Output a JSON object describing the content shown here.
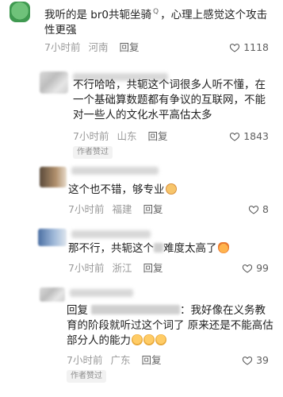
{
  "comments": [
    {
      "text_a": "我听的是 br0共轭坐骑",
      "text_sup": "Q",
      "text_b": "，心理上感觉这个攻击性更强",
      "time": "7小时前",
      "location": "河南",
      "reply_label": "回复",
      "likes": "1118"
    },
    {
      "text": "不行哈哈，共轭这个词很多人听不懂，在一个基础算数题都有争议的互联网，不能对一些人的文化水平高估太多",
      "time": "7小时前",
      "location": "山东",
      "reply_label": "回复",
      "likes": "1843",
      "badge": "作者赞过"
    },
    {
      "text": "这个也不错，够专业",
      "time": "7小时前",
      "location": "福建",
      "reply_label": "回复",
      "likes": "8"
    },
    {
      "text_a": "那不行，共轭这个",
      "text_b": "难度太高了",
      "time": "7小时前",
      "location": "浙江",
      "reply_label": "回复",
      "likes": "99"
    },
    {
      "reply_prefix": "回复",
      "text_a": "：我好像在义务教育",
      "text_b": "的阶段就听过这个词了 原来还是不能高估部分人的能力",
      "time": "7小时前",
      "location": "广东",
      "reply_label": "回复",
      "likes": "39",
      "badge": "作者赞过"
    }
  ],
  "icons": {
    "heart": "heart-outline-icon",
    "emoji_face": "smiling-face-emoji-icon",
    "emoji_cat": "scared-cat-emoji-icon"
  },
  "colors": {
    "meta": "#9a9a9a",
    "text": "#1f1f1f",
    "badge_bg": "#f2f2f2"
  }
}
